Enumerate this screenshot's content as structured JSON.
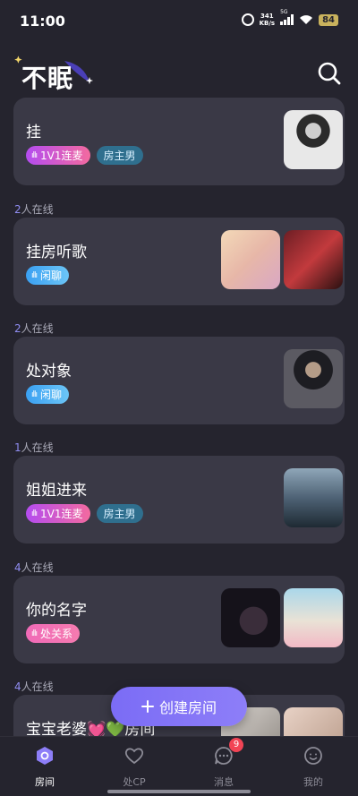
{
  "status_bar": {
    "time": "11:00",
    "net_speed_value": "341",
    "net_speed_unit": "KB/s",
    "network": "5G",
    "battery": "84"
  },
  "header": {
    "logo_text": "不眠",
    "search_icon": "search-icon"
  },
  "rooms": [
    {
      "title": "挂",
      "tags": [
        "1V1连麦",
        "房主男"
      ]
    },
    {
      "online": "2",
      "online_suffix": "人在线",
      "title": "挂房听歌",
      "tags": [
        "闲聊"
      ]
    },
    {
      "online": "2",
      "online_suffix": "人在线",
      "title": "处对象",
      "tags": [
        "闲聊"
      ]
    },
    {
      "online": "1",
      "online_suffix": "人在线",
      "title": "姐姐进来",
      "tags": [
        "1V1连麦",
        "房主男"
      ]
    },
    {
      "online": "4",
      "online_suffix": "人在线",
      "title": "你的名字",
      "tags": [
        "处关系"
      ]
    },
    {
      "online": "4",
      "online_suffix": "人在线",
      "title": "宝宝老婆💓💚房间",
      "tags": []
    }
  ],
  "create_button": {
    "label": "创建房间",
    "icon": "plus-icon"
  },
  "bottom_nav": {
    "items": [
      {
        "label": "房间",
        "icon": "room-icon",
        "active": true
      },
      {
        "label": "处CP",
        "icon": "heart-icon"
      },
      {
        "label": "消息",
        "icon": "message-icon",
        "badge": "9"
      },
      {
        "label": "我的",
        "icon": "profile-icon"
      }
    ]
  },
  "colors": {
    "background": "#25242e",
    "card": "#3a3946",
    "accent": "#7b6cf5",
    "badge": "#f24455"
  }
}
